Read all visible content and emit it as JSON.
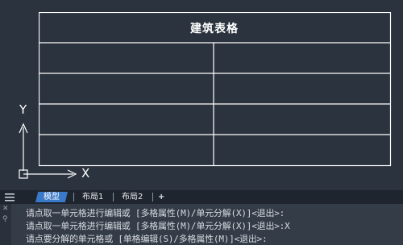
{
  "drawing": {
    "table_title": "建筑表格",
    "ucs": {
      "x_label": "X",
      "y_label": "Y"
    }
  },
  "tabs": {
    "menu_icon": "menu-icon",
    "items": [
      "模型",
      "布局1",
      "布局2",
      "+"
    ]
  },
  "command_history": {
    "lines": [
      "请点取一单元格进行编辑或 [多格属性(M)/单元分解(X)]<退出>:",
      "请点取一单元格进行编辑或 [多格属性(M)/单元分解(X)]<退出>:X",
      "请点要分解的单元格或 [单格编辑(S)/多格属性(M)]<退出>:"
    ]
  },
  "colors": {
    "canvas_bg": "#2b333e",
    "line": "#ffffff",
    "active_tab": "#3a78c8"
  }
}
